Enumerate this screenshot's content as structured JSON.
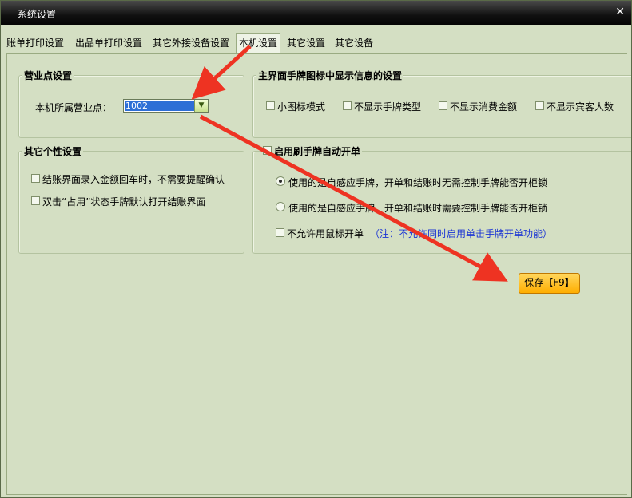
{
  "window": {
    "title": "系统设置"
  },
  "tabs": [
    {
      "label": "账单打印设置"
    },
    {
      "label": "出品单打印设置"
    },
    {
      "label": "其它外接设备设置"
    },
    {
      "label": "本机设置",
      "active": true
    },
    {
      "label": "其它设置"
    },
    {
      "label": "其它设备"
    }
  ],
  "business_point": {
    "title": "营业点设置",
    "field_label": "本机所属营业点：",
    "value": "1002"
  },
  "main_info": {
    "title": "主界面手牌图标中显示信息的设置",
    "options": [
      {
        "label": "小图标模式",
        "checked": false
      },
      {
        "label": "不显示手牌类型",
        "checked": false
      },
      {
        "label": "不显示消费金额",
        "checked": false
      },
      {
        "label": "不显示宾客人数",
        "checked": false
      }
    ]
  },
  "personal": {
    "title": "其它个性设置",
    "options": [
      {
        "label": "结账界面录入金额回车时，不需要提醒确认",
        "checked": false
      },
      {
        "label": "双击“占用”状态手牌默认打开结账界面",
        "checked": false
      }
    ]
  },
  "auto_open": {
    "title": "启用刷手牌自动开单",
    "enabled": false,
    "radio1": "使用的是自感应手牌，开单和结账时无需控制手牌能否开柜锁",
    "radio2": "使用的是自感应手牌，开单和结账时需要控制手牌能否开柜锁",
    "selected": 1,
    "mouse_label": "不允许用鼠标开单",
    "note": "（注：不允许同时启用单击手牌开单功能）"
  },
  "save_label": "保存【F9】",
  "colors": {
    "arrow": "#ee3322",
    "save_button": "#ffb400",
    "panel": "#d4dfc3"
  }
}
